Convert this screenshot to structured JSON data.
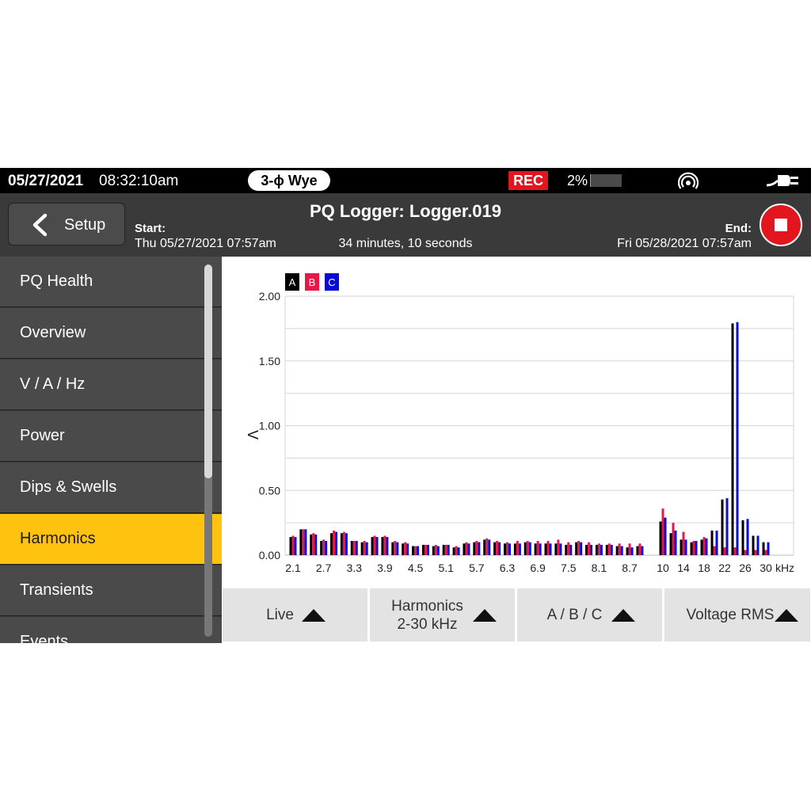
{
  "status_bar": {
    "date": "05/27/2021",
    "time": "08:32:10am",
    "wiring": "3-ϕ Wye",
    "rec_label": "REC",
    "memory_used": "2%",
    "memory_fraction": 0.02,
    "signal_icon": "wireless-signal-icon",
    "power_icon": "power-plug-icon"
  },
  "header": {
    "back_label": "Setup",
    "title": "PQ Logger: Logger.019",
    "start_label": "Start:",
    "start_value": "Thu 05/27/2021 07:57am",
    "elapsed": "34 minutes, 10 seconds",
    "end_label": "End:",
    "end_value": "Fri 05/28/2021 07:57am",
    "stop_icon": "stop-icon"
  },
  "sidebar": {
    "items": [
      {
        "label": "PQ Health"
      },
      {
        "label": "Overview"
      },
      {
        "label": "V / A / Hz"
      },
      {
        "label": "Power"
      },
      {
        "label": "Dips & Swells"
      },
      {
        "label": "Harmonics",
        "active": true
      },
      {
        "label": "Transients"
      },
      {
        "label": "Events"
      }
    ]
  },
  "toolbar": {
    "buttons": [
      {
        "label": "Live"
      },
      {
        "label": "Harmonics\n2-30 kHz"
      },
      {
        "label": "A / B / C"
      },
      {
        "label": "Voltage RMS"
      }
    ]
  },
  "colors": {
    "A": "#000000",
    "B": "#e8174a",
    "C": "#0a0ad6",
    "accent": "#ffc20e",
    "rec": "#e3161f"
  },
  "chart_data": {
    "type": "bar",
    "ylabel": "V",
    "xunit": "kHz",
    "ylim": [
      0,
      2.0
    ],
    "yticks": [
      "0.00",
      "0.50",
      "1.00",
      "1.50",
      "2.00"
    ],
    "xtick_labels": [
      "2.1",
      "2.7",
      "3.3",
      "3.9",
      "4.5",
      "5.1",
      "5.7",
      "6.3",
      "6.9",
      "7.5",
      "8.1",
      "8.7",
      "10",
      "14",
      "18",
      "22",
      "26",
      "30"
    ],
    "grid": true,
    "legend": [
      "A",
      "B",
      "C"
    ],
    "legend_position": "top-left",
    "group1_categories": [
      "2.1",
      "2.3",
      "2.5",
      "2.7",
      "2.9",
      "3.1",
      "3.3",
      "3.5",
      "3.7",
      "3.9",
      "4.1",
      "4.3",
      "4.5",
      "4.7",
      "4.9",
      "5.1",
      "5.3",
      "5.5",
      "5.7",
      "5.9",
      "6.1",
      "6.3",
      "6.5",
      "6.7",
      "6.9",
      "7.1",
      "7.3",
      "7.5",
      "7.7",
      "7.9",
      "8.1",
      "8.3",
      "8.5",
      "8.7",
      "8.9"
    ],
    "group1_series": [
      {
        "name": "A",
        "values": [
          0.14,
          0.2,
          0.16,
          0.11,
          0.17,
          0.17,
          0.11,
          0.1,
          0.14,
          0.14,
          0.1,
          0.09,
          0.07,
          0.08,
          0.07,
          0.08,
          0.06,
          0.09,
          0.1,
          0.12,
          0.1,
          0.09,
          0.09,
          0.1,
          0.09,
          0.09,
          0.09,
          0.08,
          0.1,
          0.08,
          0.08,
          0.08,
          0.07,
          0.06,
          0.07
        ]
      },
      {
        "name": "B",
        "values": [
          0.15,
          0.2,
          0.17,
          0.12,
          0.19,
          0.18,
          0.11,
          0.11,
          0.15,
          0.15,
          0.11,
          0.1,
          0.07,
          0.08,
          0.08,
          0.08,
          0.07,
          0.1,
          0.11,
          0.13,
          0.11,
          0.1,
          0.11,
          0.11,
          0.11,
          0.11,
          0.12,
          0.1,
          0.11,
          0.1,
          0.09,
          0.09,
          0.09,
          0.09,
          0.09
        ]
      },
      {
        "name": "C",
        "values": [
          0.14,
          0.2,
          0.16,
          0.11,
          0.18,
          0.17,
          0.11,
          0.1,
          0.14,
          0.14,
          0.1,
          0.09,
          0.07,
          0.08,
          0.07,
          0.08,
          0.06,
          0.09,
          0.1,
          0.12,
          0.1,
          0.09,
          0.09,
          0.1,
          0.09,
          0.09,
          0.09,
          0.08,
          0.1,
          0.08,
          0.08,
          0.08,
          0.07,
          0.06,
          0.07
        ]
      }
    ],
    "group2_categories": [
      "10",
      "12",
      "14",
      "16",
      "18",
      "20",
      "22",
      "24",
      "26",
      "28",
      "30"
    ],
    "group2_series": [
      {
        "name": "A",
        "values": [
          0.26,
          0.17,
          0.12,
          0.1,
          0.12,
          0.19,
          0.43,
          1.79,
          0.27,
          0.15,
          0.1
        ]
      },
      {
        "name": "B",
        "values": [
          0.36,
          0.25,
          0.18,
          0.11,
          0.14,
          0.07,
          0.06,
          0.06,
          0.04,
          0.04,
          0.04
        ]
      },
      {
        "name": "C",
        "values": [
          0.29,
          0.19,
          0.12,
          0.11,
          0.13,
          0.19,
          0.44,
          1.8,
          0.28,
          0.15,
          0.1
        ]
      }
    ]
  }
}
